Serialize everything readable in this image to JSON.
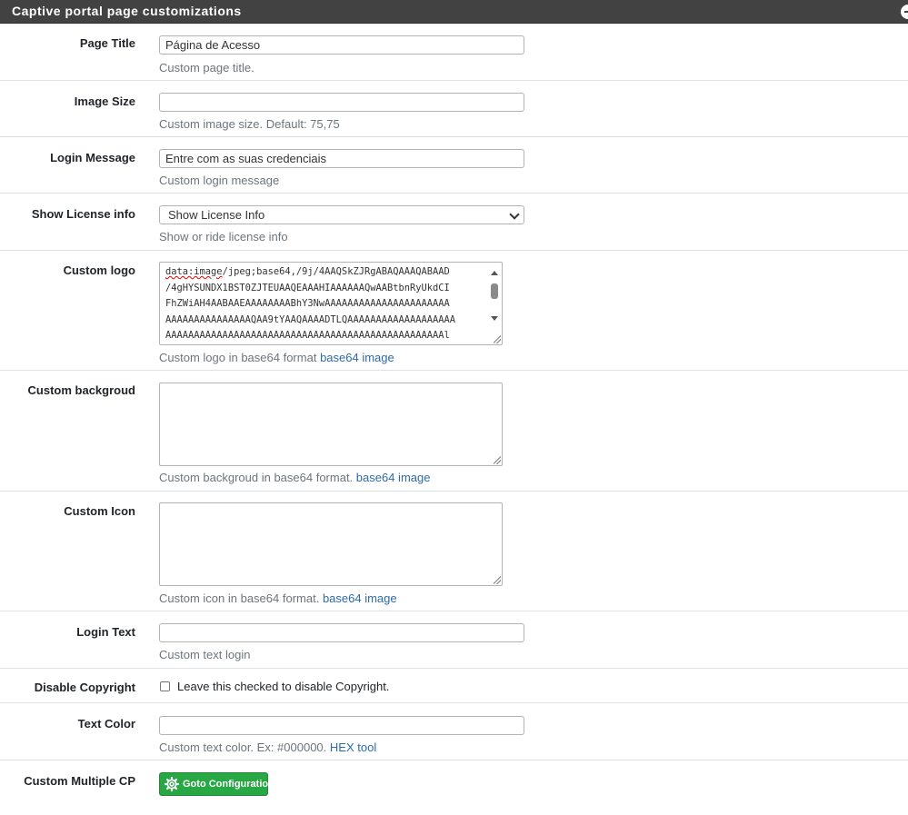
{
  "panel": {
    "title": "Captive portal page customizations"
  },
  "fields": {
    "page_title": {
      "label": "Page Title",
      "value": "Página de Acesso",
      "help": "Custom page title."
    },
    "image_size": {
      "label": "Image Size",
      "value": "",
      "help": "Custom image size. Default: 75,75"
    },
    "login_message": {
      "label": "Login Message",
      "value": "Entre com as suas credenciais",
      "help": "Custom login message"
    },
    "show_license": {
      "label": "Show License info",
      "selected": "Show License Info",
      "help": "Show or ride license info"
    },
    "custom_logo": {
      "label": "Custom logo",
      "lines": [
        [
          "data:image",
          "/jpeg;base64,/9j/4AAQSkZJRgABAQAAAQABAAD"
        ],
        [
          "",
          "/4gHYSUNDX1BST0ZJTEUAAQEAAAHIAAAAAAQwAABtbnRyUkdCI"
        ],
        [
          "",
          "FhZWiAH4AABAAEAAAAAAAABhY3NwAAAAAAAAAAAAAAAAAAAAAA"
        ],
        [
          "",
          "AAAAAAAAAAAAAAAQAA9tYAAQAAAADTLQAAAAAAAAAAAAAAAAAAA"
        ],
        [
          "",
          "AAAAAAAAAAAAAAAAAAAAAAAAAAAAAAAAAAAAAAAAAAAAAAAAAl"
        ]
      ],
      "help": "Custom logo in base64 format",
      "link": "base64 image"
    },
    "custom_background": {
      "label": "Custom backgroud",
      "value": "",
      "help": "Custom backgroud in base64 format.",
      "link": "base64 image"
    },
    "custom_icon": {
      "label": "Custom Icon",
      "value": "",
      "help": "Custom icon in base64 format.",
      "link": "base64 image"
    },
    "login_text": {
      "label": "Login Text",
      "value": "",
      "help": "Custom text login"
    },
    "disable_copyright": {
      "label": "Disable Copyright",
      "checkbox_label": "Leave this checked to disable Copyright.",
      "checked": false
    },
    "text_color": {
      "label": "Text Color",
      "value": "",
      "help": "Custom text color. Ex: #000000.",
      "link": "HEX tool"
    },
    "custom_multiple_cp": {
      "label": "Custom Multiple CP",
      "button": "Goto Configuration",
      "button_icon": "gear-icon"
    }
  },
  "colors": {
    "header_bg": "#424242",
    "link": "#2d6ba9",
    "button": "#28a745",
    "help_text": "#6c757d"
  }
}
